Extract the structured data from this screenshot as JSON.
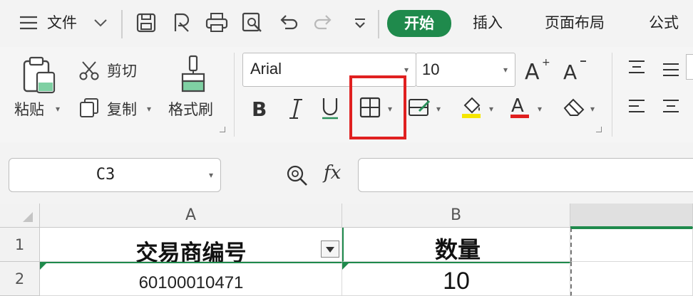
{
  "menubar": {
    "file_label": "文件",
    "tabs": [
      {
        "label": "开始"
      },
      {
        "label": "插入"
      },
      {
        "label": "页面布局"
      },
      {
        "label": "公式"
      }
    ]
  },
  "ribbon": {
    "paste_label": "粘贴",
    "cut_label": "剪切",
    "copy_label": "复制",
    "format_painter_label": "格式刷",
    "font_name": "Arial",
    "font_size": "10",
    "highlight_color": "#e02020",
    "font_color_bar": "#e02020",
    "fill_color_bar": "#f5e600",
    "accent": "#1f8a4c"
  },
  "formula_bar": {
    "name_box_value": "C3",
    "fx_label": "fx",
    "formula_value": ""
  },
  "grid": {
    "columns": [
      "A",
      "B",
      ""
    ],
    "rows": [
      {
        "row_label": "1",
        "cells": [
          "交易商编号",
          "数量",
          ""
        ]
      },
      {
        "row_label": "2",
        "cells": [
          "60100010471",
          "10",
          ""
        ]
      }
    ]
  }
}
